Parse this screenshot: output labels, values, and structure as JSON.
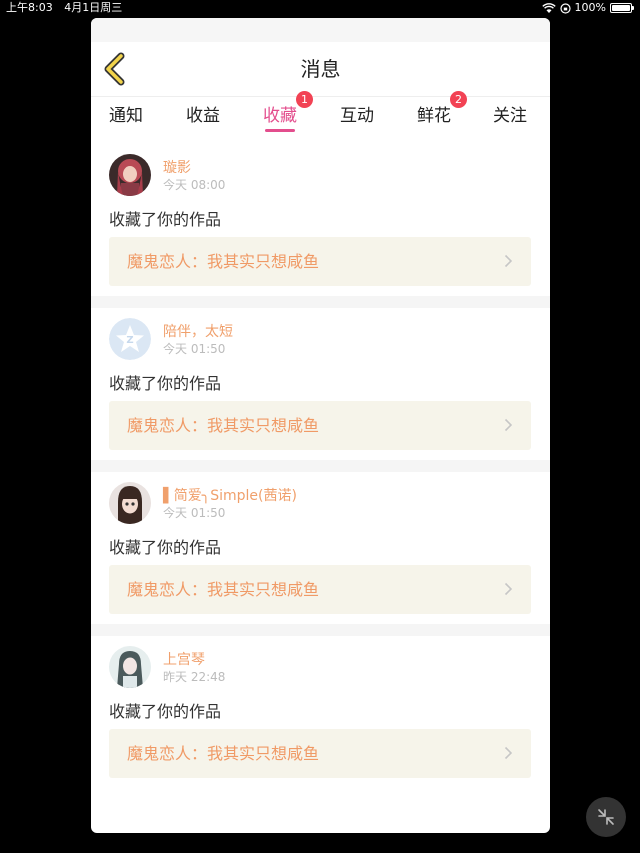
{
  "status": {
    "time": "上午8:03",
    "date": "4月1日周三",
    "battery": "100%"
  },
  "header": {
    "title": "消息"
  },
  "tabs": [
    {
      "label": "通知",
      "active": false,
      "badge": null
    },
    {
      "label": "收益",
      "active": false,
      "badge": null
    },
    {
      "label": "收藏",
      "active": true,
      "badge": "1"
    },
    {
      "label": "互动",
      "active": false,
      "badge": null
    },
    {
      "label": "鲜花",
      "active": false,
      "badge": "2"
    },
    {
      "label": "关注",
      "active": false,
      "badge": null
    }
  ],
  "feed": [
    {
      "user": "璇影",
      "time": "今天 08:00",
      "action": "收藏了你的作品",
      "work": "魔鬼恋人：我其实只想咸鱼"
    },
    {
      "user": "陪伴，太短",
      "time": "今天 01:50",
      "action": "收藏了你的作品",
      "work": "魔鬼恋人：我其实只想咸鱼"
    },
    {
      "user": "▌简爱╮Simple(茜诺)",
      "time": "今天 01:50",
      "action": "收藏了你的作品",
      "work": "魔鬼恋人：我其实只想咸鱼"
    },
    {
      "user": "上宫琴",
      "time": "昨天 22:48",
      "action": "收藏了你的作品",
      "work": "魔鬼恋人：我其实只想咸鱼"
    }
  ],
  "colors": {
    "accent": "#e34e8d",
    "badge": "#f24254",
    "username": "#f0a06c",
    "work_title": "#f09a66",
    "work_bg": "#f6f4ea"
  },
  "icons": {
    "back": "chevron-left-icon",
    "arrow": "chevron-right-icon",
    "collapse": "collapse-arrows-icon"
  }
}
